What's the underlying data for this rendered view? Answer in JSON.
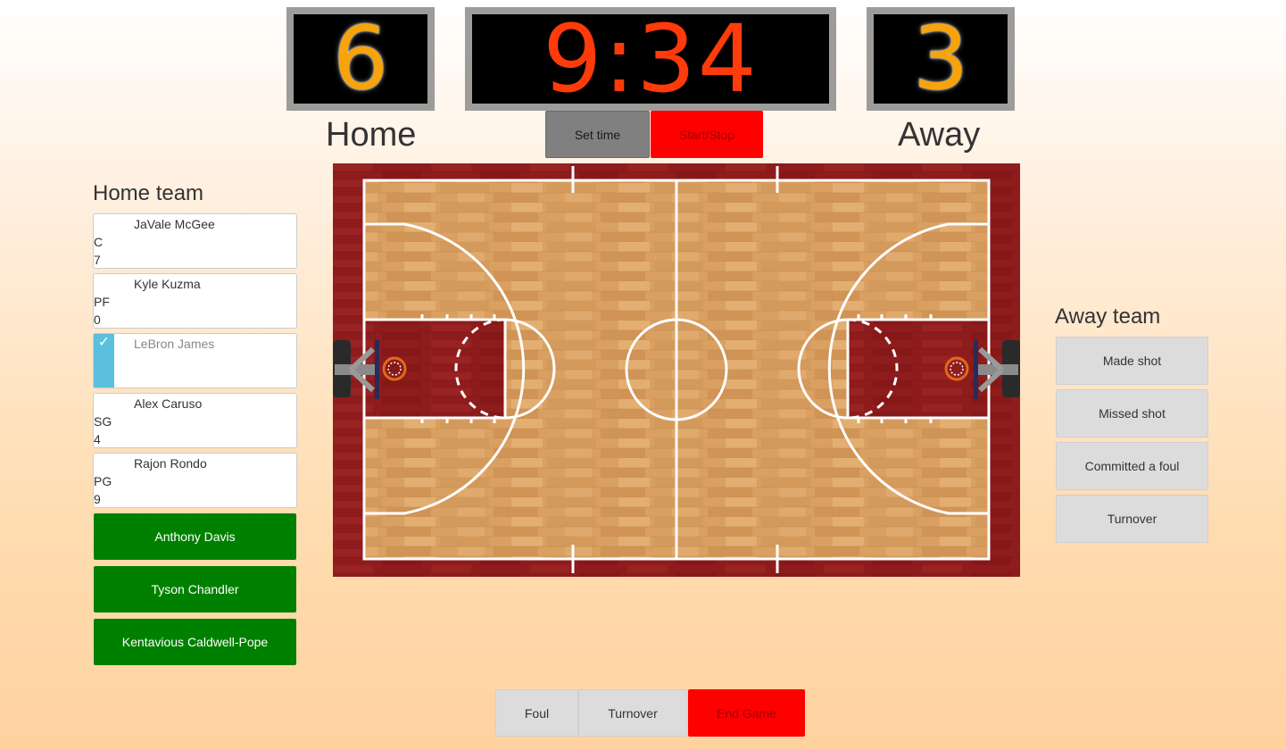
{
  "scoreboard": {
    "home_score": "6",
    "clock": "9:34",
    "away_score": "3",
    "home_label": "Home",
    "away_label": "Away",
    "set_time_label": "Set time",
    "start_stop_label": "Start/Stop"
  },
  "home_team": {
    "title": "Home team",
    "players": [
      {
        "name": "JaVale McGee",
        "position": "C",
        "number": "7"
      },
      {
        "name": "Kyle Kuzma",
        "position": "PF",
        "number": "0"
      },
      {
        "name": "LeBron James",
        "position": "",
        "number": "",
        "selected": true
      },
      {
        "name": "Alex Caruso",
        "position": "SG",
        "number": "4"
      },
      {
        "name": "Rajon Rondo",
        "position": "PG",
        "number": "9"
      }
    ],
    "bench": [
      "Anthony Davis",
      "Tyson Chandler",
      "Kentavious Caldwell-Pope"
    ]
  },
  "away_team": {
    "title": "Away team",
    "actions": [
      "Made shot",
      "Missed shot",
      "Committed a foul",
      "Turnover"
    ]
  },
  "bottom_bar": {
    "foul_label": "Foul",
    "turnover_label": "Turnover",
    "end_game_label": "End Game"
  },
  "colors": {
    "score": "#f7a30b",
    "clock": "#ff3a0b",
    "bench_green": "#008000",
    "danger_red": "#ff0000",
    "selected_blue": "#5bc0de",
    "court_border": "#8e1c1c",
    "court_wood": "#d9a062"
  },
  "check_icon": "checkmark-icon"
}
